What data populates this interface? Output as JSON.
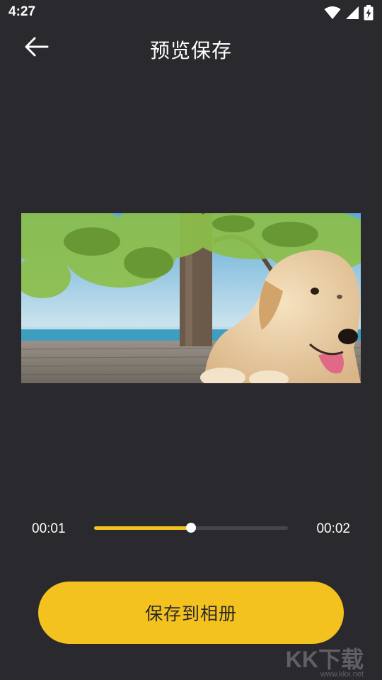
{
  "status_bar": {
    "time": "4:27",
    "icons": [
      "wifi-icon",
      "cellular-signal-icon",
      "battery-charging-icon"
    ]
  },
  "header": {
    "back_icon": "arrow-left-icon",
    "title": "预览保存"
  },
  "preview": {
    "description_icon": "video-frame",
    "colors": {
      "sky": "#7fc0dc",
      "sea": "#3f9ec0",
      "foliage": "#8cbf4a",
      "deck": "#8a8278",
      "dog": "#e9cfa6"
    }
  },
  "player": {
    "current_time": "00:01",
    "total_time": "00:02",
    "progress_fraction": 0.5,
    "accent_color": "#f4c21f"
  },
  "actions": {
    "save_label": "保存到相册"
  },
  "watermark": {
    "logo_text": "KK下载",
    "url_text": "www.kkx.net"
  }
}
